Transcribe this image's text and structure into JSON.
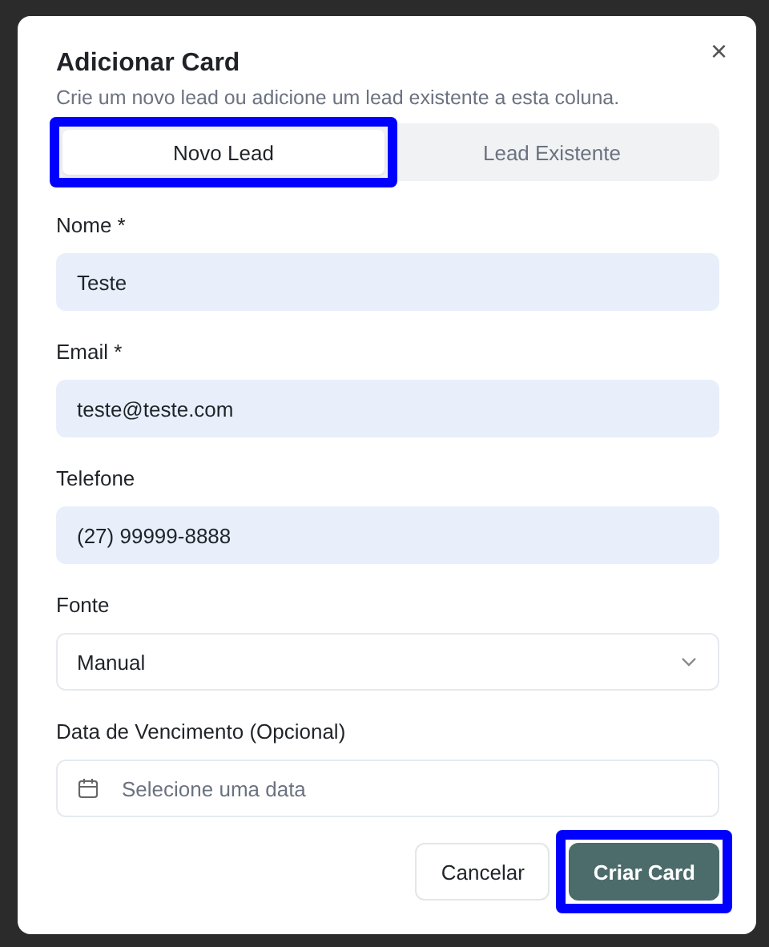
{
  "dialog": {
    "title": "Adicionar Card",
    "subtitle": "Crie um novo lead ou adicione um lead existente a esta coluna.",
    "close": "×"
  },
  "tabs": [
    {
      "label": "Novo Lead",
      "selected": true,
      "highlighted": true
    },
    {
      "label": "Lead Existente",
      "selected": false,
      "highlighted": false
    }
  ],
  "fields": [
    {
      "kind": "text",
      "label": "Nome *",
      "value": "Teste"
    },
    {
      "kind": "text",
      "label": "Email *",
      "value": "teste@teste.com"
    },
    {
      "kind": "text",
      "label": "Telefone",
      "value": "(27) 99999-8888"
    },
    {
      "kind": "select",
      "label": "Fonte",
      "value": "Manual"
    },
    {
      "kind": "date",
      "label": "Data de Vencimento (Opcional)",
      "placeholder": "Selecione uma data"
    }
  ],
  "buttons": [
    {
      "kind": "secondary",
      "label": "Cancelar",
      "highlighted": false
    },
    {
      "kind": "primary",
      "label": "Criar Card",
      "highlighted": true
    }
  ]
}
